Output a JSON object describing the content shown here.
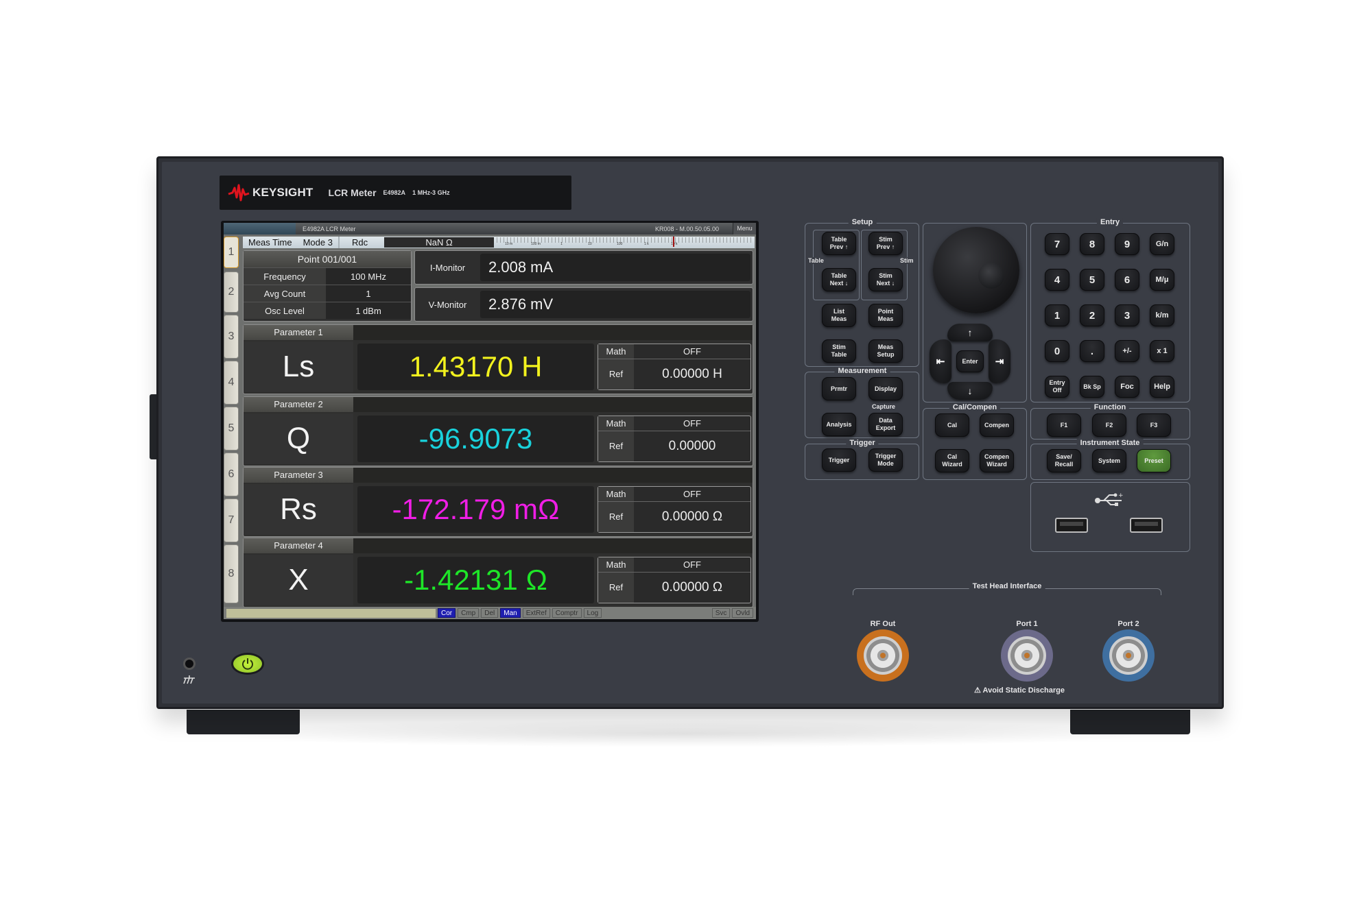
{
  "instrument": {
    "brand": "KEYSIGHT",
    "product": "LCR Meter",
    "model": "E4982A",
    "range": "1 MHz-3 GHz",
    "colors": {
      "body": "#2f3137",
      "brand_red": "#e0141e",
      "preset_green": "#4e8a33",
      "power_green": "#b5e535"
    }
  },
  "screen": {
    "titlebar": {
      "title": "E4982A LCR Meter",
      "firmware": "KR008 - M.00.50.05.00",
      "menu": "Menu"
    },
    "status": {
      "meas_time_label": "Meas Time",
      "meas_time_value": "Mode 3",
      "rdc_label": "Rdc",
      "rdc_value": "NaN Ω",
      "scale_labels": [
        "10 m",
        "100 m",
        "1",
        "10",
        "100",
        "1 k",
        "10 k"
      ],
      "scale_marker_value": "10 k"
    },
    "side_tabs": [
      "1",
      "2",
      "3",
      "4",
      "5",
      "6",
      "7",
      "8"
    ],
    "point": {
      "title": "Point 001/001",
      "rows": [
        {
          "label": "Frequency",
          "value": "100 MHz"
        },
        {
          "label": "Avg Count",
          "value": "1"
        },
        {
          "label": "Osc Level",
          "value": "1 dBm"
        }
      ]
    },
    "monitors": [
      {
        "label": "I-Monitor",
        "value": "2.008 mA"
      },
      {
        "label": "V-Monitor",
        "value": "2.876 mV"
      }
    ],
    "parameters": [
      {
        "header": "Parameter 1",
        "symbol": "Ls",
        "value": "1.43170 H",
        "color": "#f2f21e",
        "math_label": "Math",
        "math_value": "OFF",
        "ref_label": "Ref",
        "ref_value": "0.00000 H"
      },
      {
        "header": "Parameter 2",
        "symbol": "Q",
        "value": "-96.9073",
        "color": "#19d2dc",
        "math_label": "Math",
        "math_value": "OFF",
        "ref_label": "Ref",
        "ref_value": "0.00000"
      },
      {
        "header": "Parameter 3",
        "symbol": "Rs",
        "value": "-172.179 mΩ",
        "color": "#f01ee6",
        "math_label": "Math",
        "math_value": "OFF",
        "ref_label": "Ref",
        "ref_value": "0.00000 Ω"
      },
      {
        "header": "Parameter 4",
        "symbol": "X",
        "value": "-1.42131 Ω",
        "color": "#1ee628",
        "math_label": "Math",
        "math_value": "OFF",
        "ref_label": "Ref",
        "ref_value": "0.00000 Ω"
      }
    ],
    "indicators": [
      {
        "label": "Cor",
        "on": true
      },
      {
        "label": "Cmp",
        "on": false
      },
      {
        "label": "Del",
        "on": false
      },
      {
        "label": "Man",
        "on": true
      },
      {
        "label": "ExtRef",
        "on": false
      },
      {
        "label": "Comptr",
        "on": false
      },
      {
        "label": "Log",
        "on": false
      }
    ],
    "right_indicators": [
      "Svc",
      "Ovld"
    ]
  },
  "keys": {
    "setup": {
      "title": "Setup",
      "table_label": "Table",
      "stim_label": "Stim",
      "table_prev": "Table Prev ↑",
      "table_next": "Table Next ↓",
      "stim_prev": "Stim Prev ↑",
      "stim_next": "Stim Next ↓",
      "list_meas": "List Meas",
      "point_meas": "Point Meas",
      "stim_table": "Stim Table",
      "meas_setup": "Meas Setup"
    },
    "measurement": {
      "title": "Measurement",
      "prmtr": "Prmtr",
      "display": "Display",
      "capture_label": "Capture",
      "analysis": "Analysis",
      "data_export": "Data Export"
    },
    "trigger": {
      "title": "Trigger",
      "trigger": "Trigger",
      "trigger_mode": "Trigger Mode"
    },
    "nav": {
      "up": "↑",
      "down": "↓",
      "left": "⇤",
      "right": "⇥",
      "enter": "Enter"
    },
    "cal": {
      "title": "Cal/Compen",
      "cal": "Cal",
      "compen": "Compen",
      "cal_wizard": "Cal Wizard",
      "compen_wizard": "Compen Wizard"
    },
    "entry": {
      "title": "Entry",
      "rows": [
        [
          "7",
          "8",
          "9",
          "G/n"
        ],
        [
          "4",
          "5",
          "6",
          "M/μ"
        ],
        [
          "1",
          "2",
          "3",
          "k/m"
        ],
        [
          "0",
          ".",
          "+/-",
          "x 1"
        ],
        [
          "Entry Off",
          "Bk Sp",
          "Foc",
          "Help"
        ]
      ]
    },
    "function": {
      "title": "Function",
      "keys": [
        "F1",
        "F2",
        "F3"
      ]
    },
    "state": {
      "title": "Instrument State",
      "save_recall": "Save/ Recall",
      "system": "System",
      "preset": "Preset"
    }
  },
  "ports": {
    "title": "Test Head Interface",
    "rf_out": "RF Out",
    "port1": "Port 1",
    "port2": "Port 2",
    "warning": "⚠ Avoid Static Discharge",
    "colors": {
      "rf_out": "#c8701e",
      "port1": "#6c6a8a",
      "port2": "#3f6fa0"
    }
  }
}
